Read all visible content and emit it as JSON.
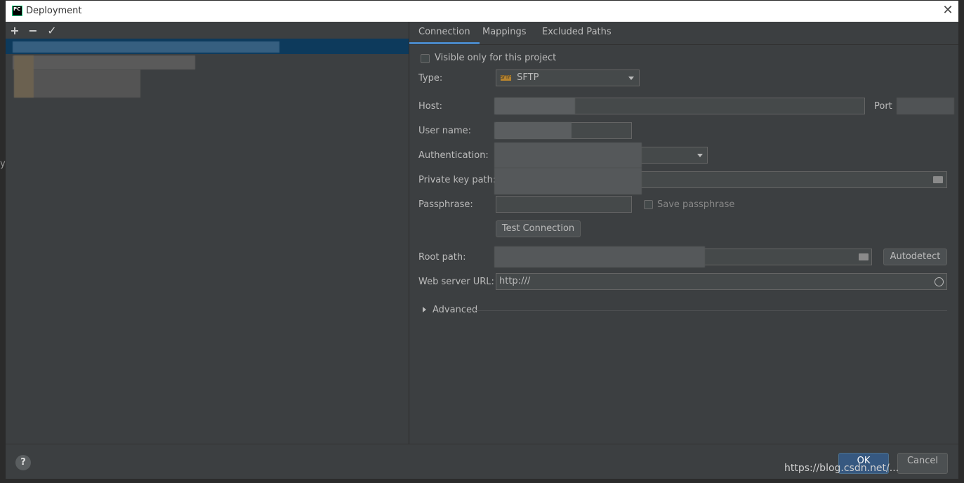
{
  "window": {
    "title": "Deployment",
    "close_glyph": "✕",
    "app_icon_text": "PC"
  },
  "toolbar": {
    "add": "+",
    "remove": "−",
    "apply": "✓"
  },
  "tabs": [
    {
      "label": "Connection"
    },
    {
      "label": "Mappings"
    },
    {
      "label": "Excluded Paths"
    }
  ],
  "connection": {
    "visible_only_label": "Visible only for this project",
    "type_label": "Type:",
    "type_value": "SFTP",
    "type_icon_text": "SFTP",
    "host_label": "Host:",
    "port_label": "Port",
    "username_label": "User name:",
    "auth_label": "Authentication:",
    "private_key_label": "Private key path:",
    "passphrase_label": "Passphrase:",
    "save_passphrase_label": "Save passphrase",
    "test_connection_label": "Test Connection",
    "root_path_label": "Root path:",
    "autodetect_label": "Autodetect",
    "web_url_label": "Web server URL:",
    "web_url_value": "http:///",
    "advanced_label": "Advanced"
  },
  "footer": {
    "help": "?",
    "ok": "OK",
    "cancel": "Cancel"
  },
  "watermark": "https://blog.csdn.net/..."
}
